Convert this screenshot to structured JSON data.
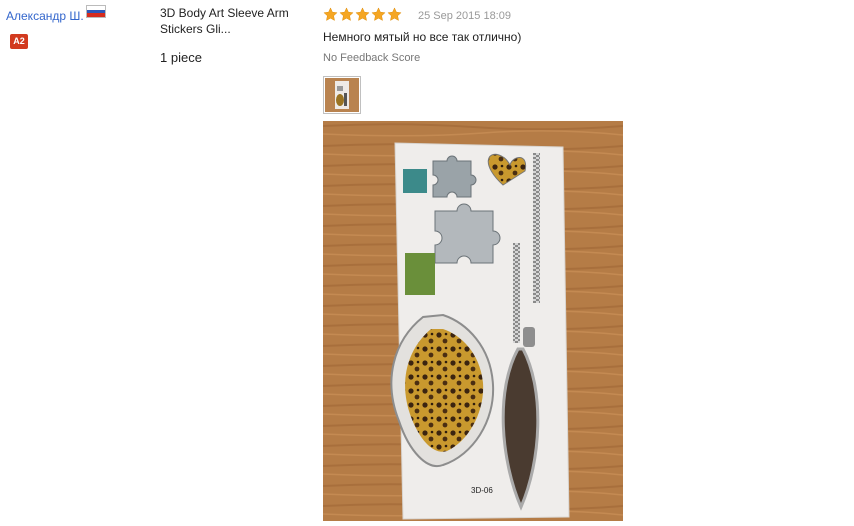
{
  "user": {
    "name": "Александр Ш.",
    "level": "A2",
    "flag_colors": [
      "#ffffff",
      "#2c56b8",
      "#d52b1e"
    ]
  },
  "product": {
    "title": "3D Body Art Sleeve Arm Stickers Gli...",
    "quantity": "1 piece"
  },
  "review": {
    "rating": 5,
    "star_color": "#f5a623",
    "date": "25 Sep 2015 18:09",
    "text": "Немного мятый но все так отлично)",
    "feedback_score": "No Feedback Score",
    "photo_label": "3D-06"
  }
}
